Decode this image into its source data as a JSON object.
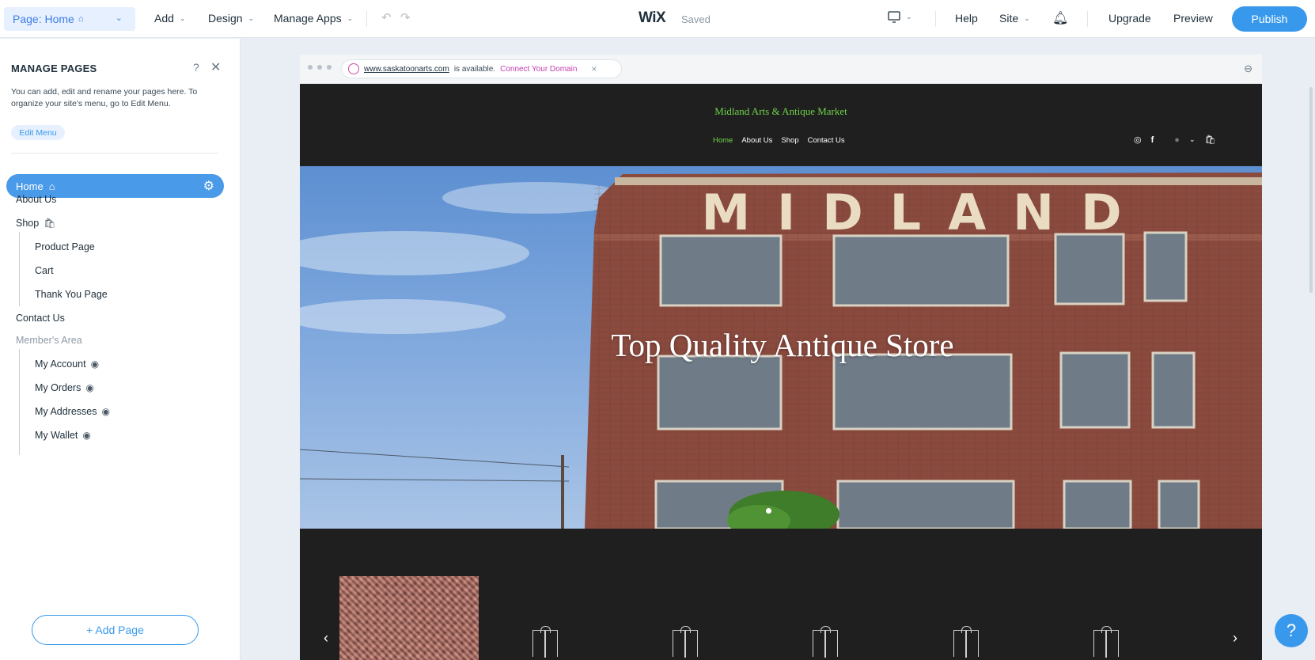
{
  "topbar": {
    "page_selector": "Page: Home",
    "add": "Add",
    "design": "Design",
    "manage_apps": "Manage Apps",
    "logo": "WiX",
    "status": "Saved",
    "help": "Help",
    "site": "Site",
    "upgrade": "Upgrade",
    "preview": "Preview",
    "publish": "Publish"
  },
  "panel": {
    "title": "MANAGE PAGES",
    "help_glyph": "?",
    "close_glyph": "✕",
    "description": "You can add, edit and rename your pages here. To organize your site's menu, go to Edit Menu.",
    "edit_menu": "Edit Menu",
    "pages": {
      "home": "Home",
      "about": "About Us",
      "shop": "Shop",
      "product": "Product Page",
      "cart": "Cart",
      "thank_you": "Thank You Page",
      "contact": "Contact Us",
      "members": "Member's Area",
      "account": "My Account",
      "orders": "My Orders",
      "addresses": "My Addresses",
      "wallet": "My Wallet"
    },
    "add_page": "+ Add Page"
  },
  "browser": {
    "url": "www.saskatoonarts.com",
    "available": "is available.",
    "connect": "Connect Your Domain",
    "close_glyph": "×"
  },
  "site": {
    "title": "Midland Arts & Antique Market",
    "nav": [
      "Home",
      "About Us",
      "Shop",
      "Contact Us"
    ],
    "hero_text": "Top Quality Antique Store",
    "hero_sign": "MIDLAND"
  },
  "help_bubble": "?",
  "colors": {
    "accent": "#3899ec",
    "site_green": "#6fd44a",
    "connect_magenta": "#c13fb0",
    "brick": "#8a4a3e"
  }
}
